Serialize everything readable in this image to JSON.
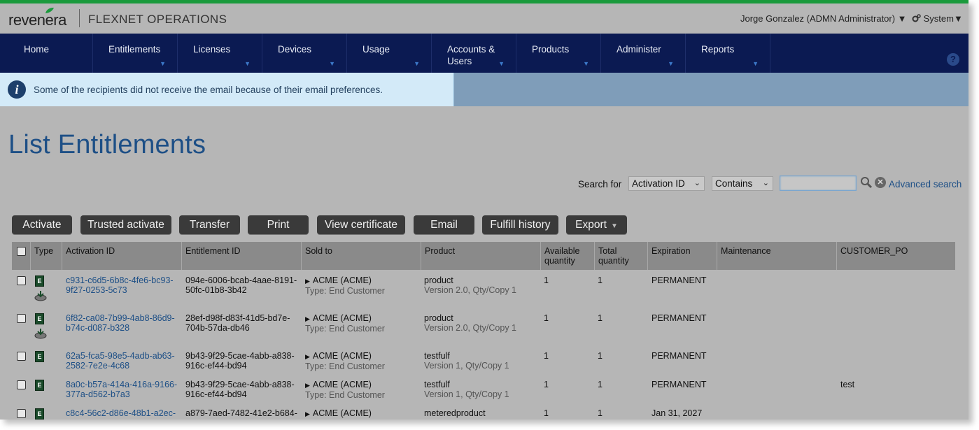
{
  "header": {
    "brand": "revenera",
    "product": "FLEXNET OPERATIONS",
    "user": "Jorge Gonzalez (ADMN Administrator) ▼",
    "system": "System▼"
  },
  "nav": [
    {
      "label": "Home",
      "has_menu": false
    },
    {
      "label": "Entitlements",
      "has_menu": true
    },
    {
      "label": "Licenses",
      "has_menu": true
    },
    {
      "label": "Devices",
      "has_menu": true
    },
    {
      "label": "Usage",
      "has_menu": true
    },
    {
      "label": "Accounts &",
      "label2": "Users",
      "has_menu": true
    },
    {
      "label": "Products",
      "has_menu": true
    },
    {
      "label": "Administer",
      "has_menu": true
    },
    {
      "label": "Reports",
      "has_menu": true
    }
  ],
  "help": "?",
  "info_message": "Some of the recipients did not receive the email because of their email preferences.",
  "page_title": "List Entitlements",
  "search": {
    "label": "Search for",
    "field": "Activation ID",
    "operator": "Contains",
    "value": "",
    "advanced": "Advanced search"
  },
  "toolbar": {
    "activate": "Activate",
    "trusted_activate": "Trusted activate",
    "transfer": "Transfer",
    "print": "Print",
    "view_certificate": "View certificate",
    "email": "Email",
    "fulfill_history": "Fulfill history",
    "export": "Export"
  },
  "columns": {
    "type": "Type",
    "activation_id": "Activation ID",
    "entitlement_id": "Entitlement ID",
    "sold_to": "Sold to",
    "product": "Product",
    "available_quantity_1": "Available",
    "available_quantity_2": "quantity",
    "total_quantity_1": "Total",
    "total_quantity_2": "quantity",
    "expiration": "Expiration",
    "maintenance": "Maintenance",
    "customer_po": "CUSTOMER_PO"
  },
  "rows": [
    {
      "type": "E",
      "activation_id_1": "c931-c6d5-6b8c-4fe6-bc93-",
      "activation_id_2": "9f27-0253-5c73",
      "entitlement_id_1": "094e-6006-bcab-4aae-8191-",
      "entitlement_id_2": "50fc-01b8-3b42",
      "sold_to": "ACME (ACME)",
      "sold_to_type": "Type: End Customer",
      "product": "product",
      "product_detail": "Version 2.0, Qty/Copy 1",
      "available": "1",
      "total": "1",
      "expiration": "PERMANENT",
      "maintenance": "",
      "customer_po": ""
    },
    {
      "type": "E",
      "activation_id_1": "6f82-ca08-7b99-4ab8-86d9-",
      "activation_id_2": "b74c-d087-b328",
      "entitlement_id_1": "28ef-d98f-d83f-41d5-bd7e-",
      "entitlement_id_2": "704b-57da-db46",
      "sold_to": "ACME (ACME)",
      "sold_to_type": "Type: End Customer",
      "product": "product",
      "product_detail": "Version 2.0, Qty/Copy 1",
      "available": "1",
      "total": "1",
      "expiration": "PERMANENT",
      "maintenance": "",
      "customer_po": ""
    },
    {
      "type": "E",
      "activation_id_1": "62a5-fca5-98e5-4adb-ab63-",
      "activation_id_2": "2582-7e2e-4c68",
      "entitlement_id_1": "9b43-9f29-5cae-4abb-a838-",
      "entitlement_id_2": "916c-ef44-bd94",
      "sold_to": "ACME (ACME)",
      "sold_to_type": "Type: End Customer",
      "product": "testfulf",
      "product_detail": "Version 1, Qty/Copy 1",
      "available": "1",
      "total": "1",
      "expiration": "PERMANENT",
      "maintenance": "",
      "customer_po": ""
    },
    {
      "type": "E",
      "activation_id_1": "8a0c-b57a-414a-416a-9166-",
      "activation_id_2": "377a-d562-b7a3",
      "entitlement_id_1": "9b43-9f29-5cae-4abb-a838-",
      "entitlement_id_2": "916c-ef44-bd94",
      "sold_to": "ACME (ACME)",
      "sold_to_type": "Type: End Customer",
      "product": "testfulf",
      "product_detail": "Version 1, Qty/Copy 1",
      "available": "1",
      "total": "1",
      "expiration": "PERMANENT",
      "maintenance": "",
      "customer_po": "test"
    },
    {
      "type": "E",
      "activation_id_1": "c8c4-56c2-d86e-48b1-a2ec-",
      "activation_id_2": "",
      "entitlement_id_1": "a879-7aed-7482-41e2-b684-",
      "entitlement_id_2": "",
      "sold_to": "ACME (ACME)",
      "sold_to_type": "",
      "product": "meteredproduct",
      "product_detail": "",
      "available": "1",
      "total": "1",
      "expiration": "Jan 31, 2027",
      "maintenance": "",
      "customer_po": ""
    }
  ],
  "colors": {
    "accent_stripe": "#1a9a3c",
    "nav_bg": "#0b1a52",
    "link": "#1d4f86",
    "button_bg": "#3a3a3a"
  }
}
